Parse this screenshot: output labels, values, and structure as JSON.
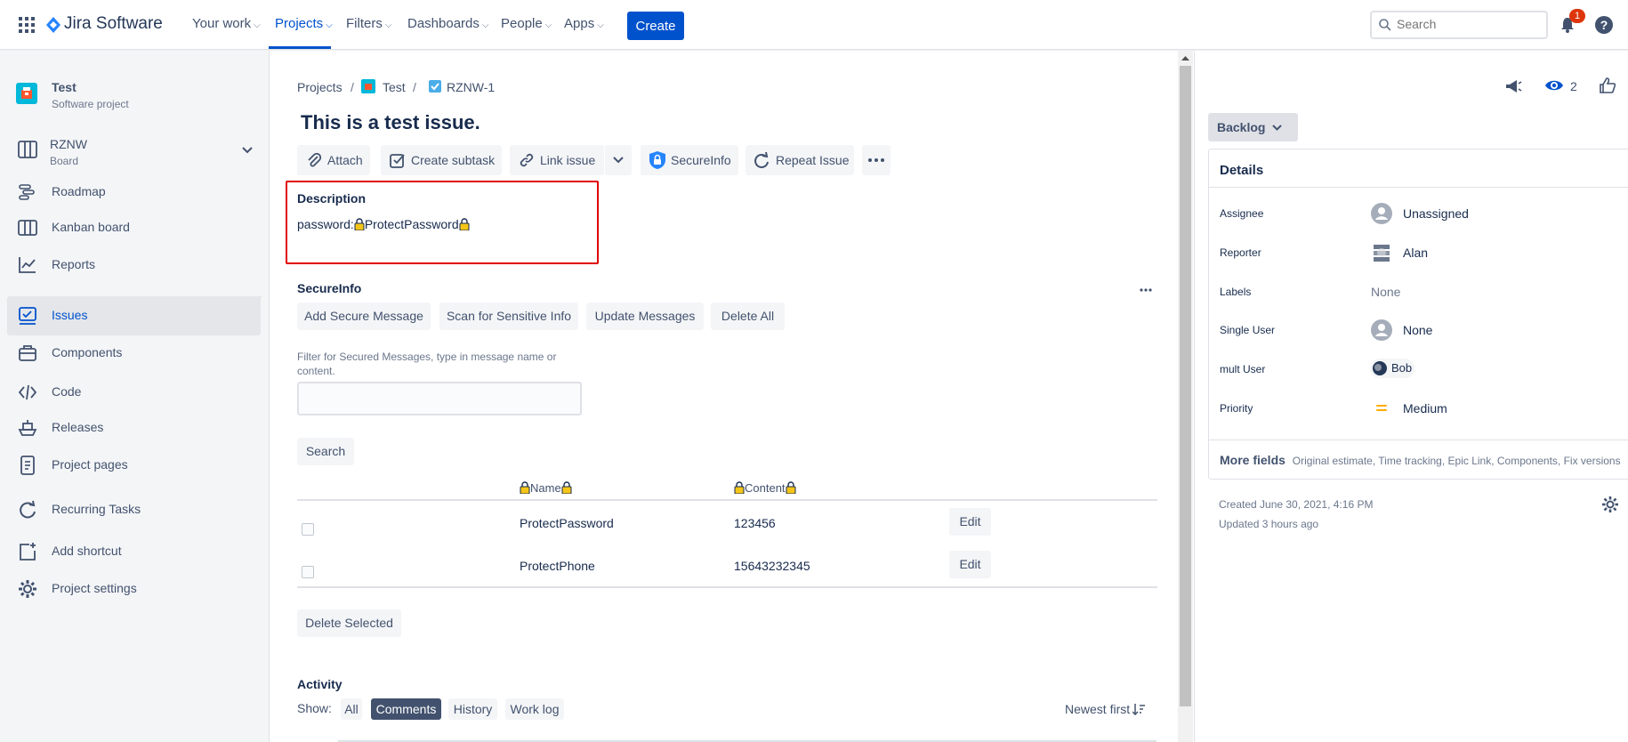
{
  "nav": {
    "app_name": "Jira Software",
    "items": [
      {
        "label": "Your work"
      },
      {
        "label": "Projects"
      },
      {
        "label": "Filters"
      },
      {
        "label": "Dashboards"
      },
      {
        "label": "People"
      },
      {
        "label": "Apps"
      }
    ],
    "create_label": "Create",
    "search_placeholder": "Search",
    "notification_count": "1",
    "colors": {
      "primary": "#0052cc",
      "badge": "#de350b"
    }
  },
  "sidebar": {
    "project_name": "Test",
    "project_type": "Software project",
    "board_name": "RZNW",
    "board_label": "Board",
    "items": [
      {
        "label": "Roadmap",
        "icon": "roadmap-icon"
      },
      {
        "label": "Kanban board",
        "icon": "kanban-icon"
      },
      {
        "label": "Reports",
        "icon": "reports-icon"
      },
      {
        "label": "Issues",
        "icon": "issues-icon"
      },
      {
        "label": "Components",
        "icon": "components-icon"
      },
      {
        "label": "Code",
        "icon": "code-icon"
      },
      {
        "label": "Releases",
        "icon": "releases-icon"
      },
      {
        "label": "Project pages",
        "icon": "pages-icon"
      },
      {
        "label": "Recurring Tasks",
        "icon": "recurring-icon"
      },
      {
        "label": "Add shortcut",
        "icon": "add-shortcut-icon"
      },
      {
        "label": "Project settings",
        "icon": "gear-icon"
      }
    ]
  },
  "breadcrumb": {
    "projects": "Projects",
    "project": "Test",
    "issue_key": "RZNW-1"
  },
  "issue": {
    "title": "This is a test issue.",
    "toolbar": {
      "attach": "Attach",
      "create_subtask": "Create subtask",
      "link_issue": "Link issue",
      "secureinfo": "SecureInfo",
      "repeat_issue": "Repeat Issue"
    },
    "description_heading": "Description",
    "description_prefix": "password:",
    "description_value": "ProtectPassword"
  },
  "secureinfo": {
    "heading": "SecureInfo",
    "buttons": {
      "add": "Add Secure Message",
      "scan": "Scan for Sensitive Info",
      "update": "Update Messages",
      "delete_all": "Delete All"
    },
    "filter_label": "Filter for Secured Messages, type in message name or content.",
    "filter_value": "",
    "search_label": "Search",
    "columns": {
      "name": "Name",
      "content": "Content"
    },
    "rows": [
      {
        "name": "ProtectPassword",
        "content": "123456",
        "action": "Edit"
      },
      {
        "name": "ProtectPhone",
        "content": "15643232345",
        "action": "Edit"
      }
    ],
    "delete_selected": "Delete Selected"
  },
  "activity": {
    "heading": "Activity",
    "show_label": "Show:",
    "filters": [
      "All",
      "Comments",
      "History",
      "Work log"
    ],
    "active_filter": "Comments",
    "sort_label": "Newest first"
  },
  "right": {
    "watchers": "2",
    "status": "Backlog",
    "details_heading": "Details",
    "fields": {
      "assignee_label": "Assignee",
      "assignee_value": "Unassigned",
      "reporter_label": "Reporter",
      "reporter_value": "Alan",
      "labels_label": "Labels",
      "labels_value": "None",
      "single_user_label": "Single User",
      "single_user_value": "None",
      "mult_user_label": "mult User",
      "mult_user_value": "Bob",
      "priority_label": "Priority",
      "priority_value": "Medium"
    },
    "more_fields_label": "More fields",
    "more_fields_list": "Original estimate, Time tracking, Epic Link, Components, Fix versions",
    "created": "Created June 30, 2021, 4:16 PM",
    "updated": "Updated 3 hours ago"
  }
}
